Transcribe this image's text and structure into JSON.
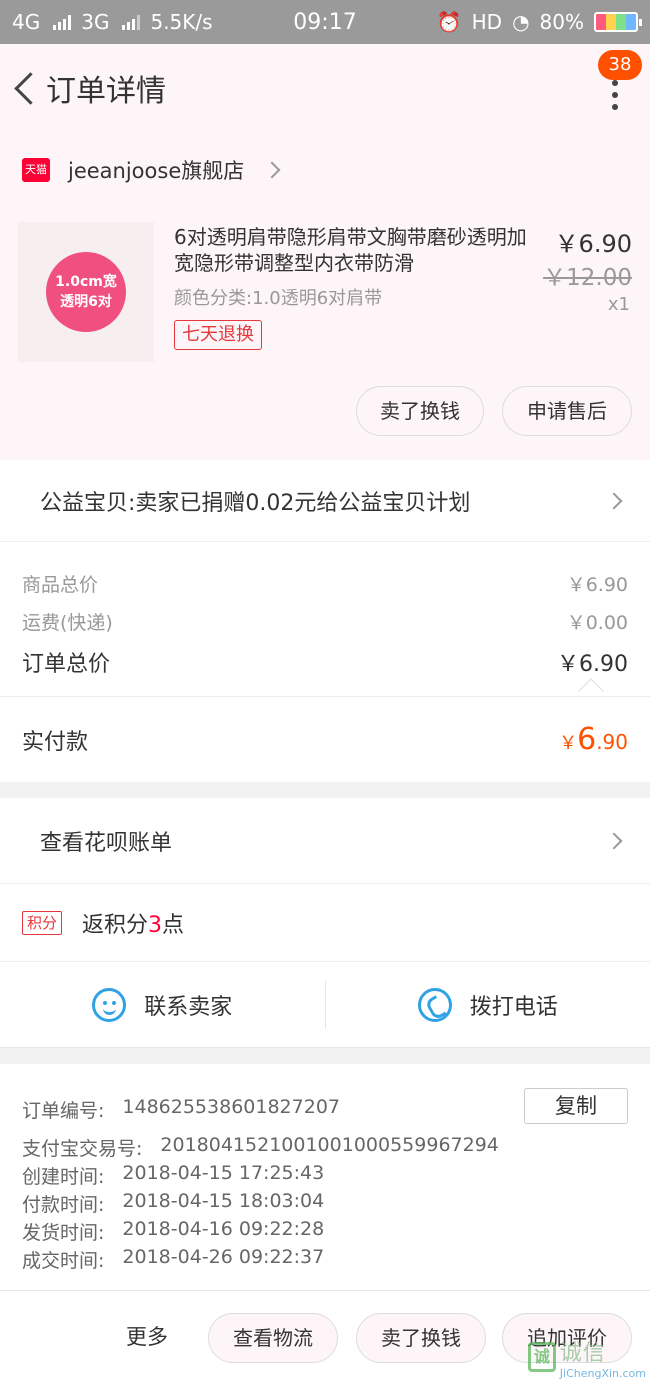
{
  "status_bar": {
    "network_1": "4G",
    "network_2": "3G",
    "speed": "5.5K/s",
    "time": "09:17",
    "hd": "HD",
    "battery": "80%"
  },
  "header": {
    "title": "订单详情",
    "badge": "38"
  },
  "shop": {
    "tmall_logo_text": "天猫",
    "name": "jeeanjoose旗舰店"
  },
  "item": {
    "thumb_line1": "1.0cm宽",
    "thumb_line2": "透明6对",
    "title": "6对透明肩带隐形肩带文胸带磨砂透明加宽隐形带调整型内衣带防滑",
    "sku": "颜色分类:1.0透明6对肩带",
    "tag": "七天退换",
    "price": "￥6.90",
    "original_price": "￥12.00",
    "quantity": "x1",
    "btn_resell": "卖了换钱",
    "btn_aftersale": "申请售后"
  },
  "charity": {
    "text": "公益宝贝:卖家已捐赠0.02元给公益宝贝计划"
  },
  "totals": {
    "goods_label": "商品总价",
    "goods_value": "￥6.90",
    "shipping_label": "运费(快递)",
    "shipping_value": "￥0.00",
    "order_label": "订单总价",
    "order_value": "￥6.90"
  },
  "paid": {
    "label": "实付款",
    "currency": "￥",
    "integer": "6",
    "decimal": ".90"
  },
  "huabei": {
    "text": "查看花呗账单"
  },
  "points": {
    "tag": "积分",
    "prefix": "返积分",
    "number": "3",
    "suffix": "点"
  },
  "contact": {
    "seller": "联系卖家",
    "phone": "拨打电话"
  },
  "order_info": {
    "order_no_label": "订单编号:",
    "order_no": "148625538601827207",
    "copy_label": "复制",
    "alipay_label": "支付宝交易号:",
    "alipay_no": "2018041521001001000559967294",
    "created_label": "创建时间:",
    "created": "2018-04-15 17:25:43",
    "paid_label": "付款时间:",
    "paid": "2018-04-15 18:03:04",
    "shipped_label": "发货时间:",
    "shipped": "2018-04-16 09:22:28",
    "completed_label": "成交时间:",
    "completed": "2018-04-26 09:22:37"
  },
  "actions": {
    "more": "更多",
    "logistics": "查看物流",
    "resell": "卖了换钱",
    "review": "追加评价"
  },
  "watermark": {
    "logo": "诚",
    "cn": "诚信",
    "en": "JiChengXin.com"
  },
  "colors": {
    "accent": "#ff5000",
    "tmall_red": "#ff0036",
    "blue_icon": "#2fa3e6"
  }
}
